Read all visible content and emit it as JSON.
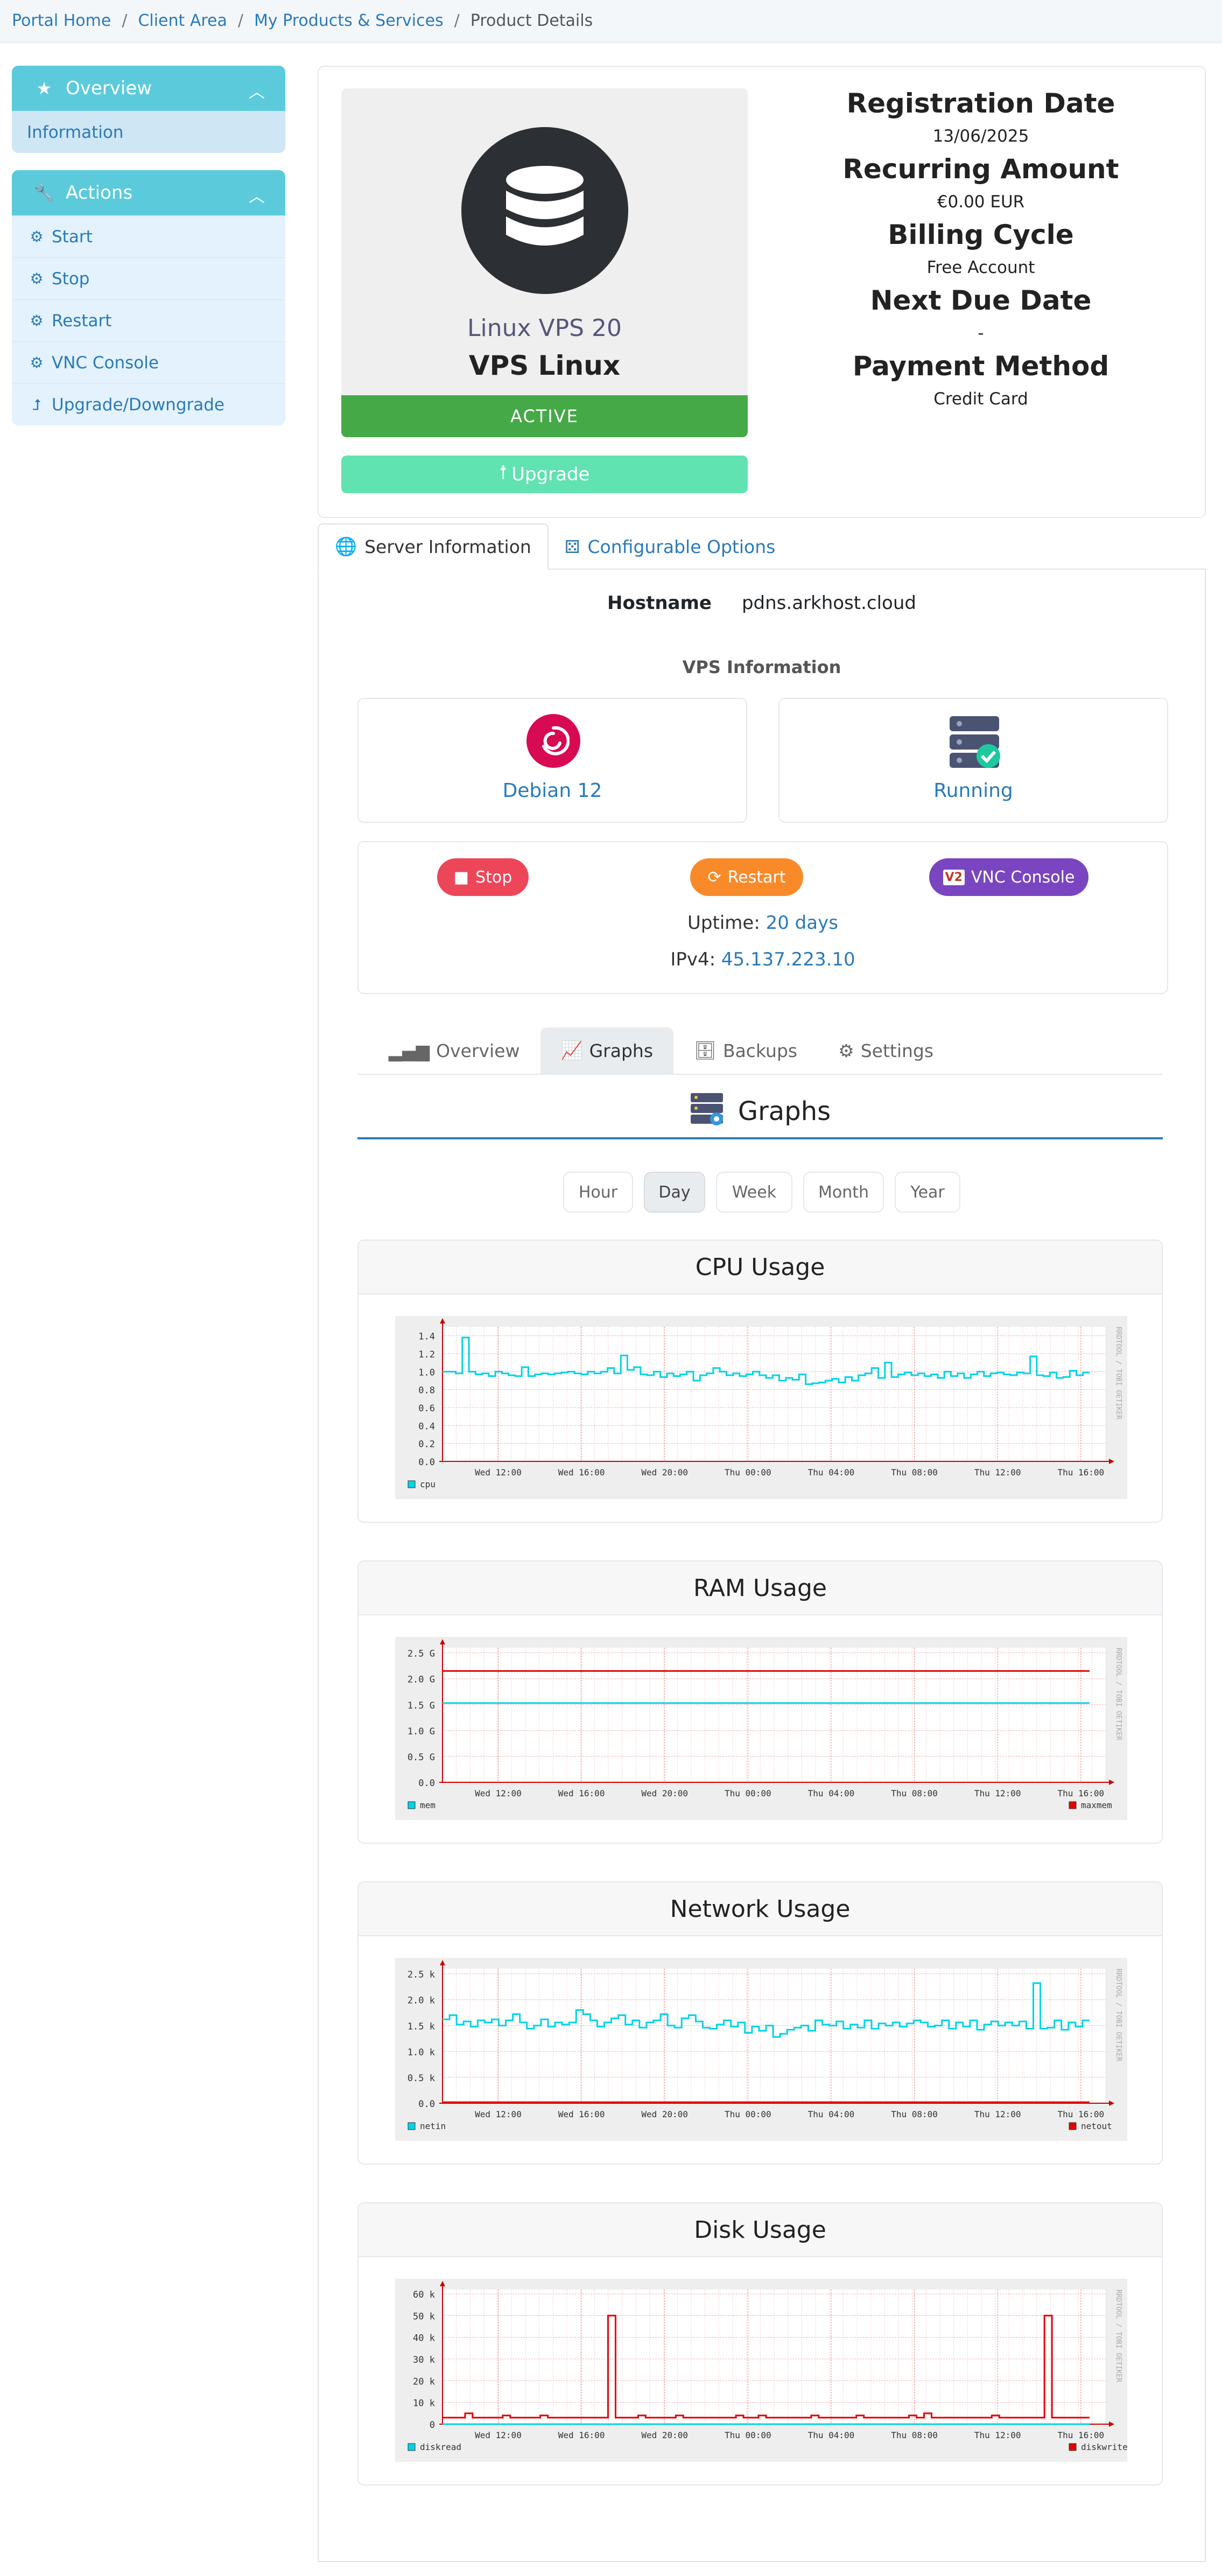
{
  "breadcrumb": {
    "items": [
      "Portal Home",
      "Client Area",
      "My Products & Services"
    ],
    "current": "Product Details",
    "sep": "/"
  },
  "sidebar": {
    "overview": {
      "title": "Overview",
      "items": [
        "Information"
      ]
    },
    "actions": {
      "title": "Actions",
      "items": [
        "Start",
        "Stop",
        "Restart",
        "VNC Console",
        "Upgrade/Downgrade"
      ]
    }
  },
  "product": {
    "name": "Linux VPS 20",
    "group": "VPS Linux",
    "status": "ACTIVE",
    "upgrade_label": "Upgrade",
    "info": [
      {
        "label": "Registration Date",
        "value": "13/06/2025"
      },
      {
        "label": "Recurring Amount",
        "value": "€0.00 EUR"
      },
      {
        "label": "Billing Cycle",
        "value": "Free Account"
      },
      {
        "label": "Next Due Date",
        "value": "-"
      },
      {
        "label": "Payment Method",
        "value": "Credit Card"
      }
    ]
  },
  "tabs": {
    "server": "Server Information",
    "config": "Configurable Options"
  },
  "server": {
    "hostname_label": "Hostname",
    "hostname": "pdns.arkhost.cloud",
    "vps_info_title": "VPS Information",
    "os": "Debian 12",
    "state": "Running",
    "buttons": {
      "stop": "Stop",
      "restart": "Restart",
      "vnc": "VNC Console"
    },
    "uptime_label": "Uptime:",
    "uptime": "20 days",
    "ipv4_label": "IPv4:",
    "ipv4": "45.137.223.10"
  },
  "subtabs": [
    "Overview",
    "Graphs",
    "Backups",
    "Settings"
  ],
  "graphs": {
    "title": "Graphs",
    "ranges": [
      "Hour",
      "Day",
      "Week",
      "Month",
      "Year"
    ],
    "active_range": "Day",
    "watermark": "RRDTOOL / TOBI OETIKER",
    "x_ticks": [
      "Wed 12:00",
      "Wed 16:00",
      "Wed 20:00",
      "Thu 00:00",
      "Thu 04:00",
      "Thu 08:00",
      "Thu 12:00",
      "Thu 16:00"
    ]
  },
  "colors": {
    "cyan": "#00d4e6",
    "red": "#e60000",
    "active": "#46a948",
    "upgrade": "#61e2b1",
    "stop": "#ee4659",
    "restart": "#f98a2a",
    "vnc": "#7a45c0"
  },
  "chart_data": [
    {
      "type": "line",
      "title": "CPU Usage",
      "y_ticks": [
        "1.4",
        "1.2",
        "1.0",
        "0.8",
        "0.6",
        "0.4",
        "0.2",
        "0.0"
      ],
      "ylim": [
        0,
        1.5
      ],
      "series": [
        {
          "name": "cpu",
          "color": "#00d4e6",
          "values": [
            1.0,
            1.0,
            0.98,
            1.38,
            1.0,
            0.97,
            0.98,
            0.95,
            1.0,
            0.98,
            0.96,
            0.95,
            1.05,
            0.95,
            0.97,
            0.98,
            0.97,
            0.98,
            0.99,
            1.0,
            0.98,
            0.97,
            1.0,
            0.98,
            1.0,
            1.04,
            0.98,
            1.18,
            1.02,
            1.05,
            0.97,
            0.96,
            1.0,
            0.94,
            0.98,
            0.95,
            0.97,
            1.0,
            0.9,
            0.96,
            0.98,
            1.04,
            1.0,
            0.96,
            0.98,
            0.95,
            0.97,
            1.0,
            0.96,
            0.93,
            0.96,
            0.9,
            0.93,
            0.91,
            0.97,
            0.86,
            0.87,
            0.88,
            0.9,
            0.92,
            0.88,
            0.94,
            0.9,
            0.96,
            0.98,
            1.04,
            0.93,
            1.1,
            0.94,
            0.97,
            0.99,
            0.96,
            0.98,
            0.95,
            0.97,
            0.93,
            1.0,
            0.95,
            0.98,
            0.93,
            0.97,
            1.0,
            0.95,
            0.98,
            0.99,
            0.97,
            0.96,
            0.99,
            0.98,
            1.17,
            0.96,
            0.95,
            0.99,
            0.93,
            0.94,
            1.01,
            0.96,
            0.99
          ]
        }
      ]
    },
    {
      "type": "line",
      "title": "RAM Usage",
      "y_ticks": [
        "2.5 G",
        "2.0 G",
        "1.5 G",
        "1.0 G",
        "0.5 G",
        "0.0"
      ],
      "ylim": [
        0,
        2.6
      ],
      "series": [
        {
          "name": "mem",
          "color": "#00d4e6",
          "values": [
            1.53,
            1.53
          ]
        },
        {
          "name": "maxmem",
          "color": "#e60000",
          "values": [
            2.15,
            2.15
          ]
        }
      ]
    },
    {
      "type": "line",
      "title": "Network Usage",
      "y_ticks": [
        "2.5 k",
        "2.0 k",
        "1.5 k",
        "1.0 k",
        "0.5 k",
        "0.0"
      ],
      "ylim": [
        0,
        2.6
      ],
      "series": [
        {
          "name": "netin",
          "color": "#00d4e6",
          "values": [
            1.62,
            1.7,
            1.52,
            1.58,
            1.48,
            1.6,
            1.56,
            1.62,
            1.5,
            1.6,
            1.72,
            1.56,
            1.44,
            1.5,
            1.62,
            1.48,
            1.56,
            1.52,
            1.56,
            1.8,
            1.72,
            1.6,
            1.48,
            1.56,
            1.64,
            1.7,
            1.52,
            1.6,
            1.46,
            1.56,
            1.6,
            1.72,
            1.5,
            1.46,
            1.64,
            1.7,
            1.58,
            1.46,
            1.44,
            1.52,
            1.6,
            1.48,
            1.56,
            1.36,
            1.48,
            1.4,
            1.5,
            1.28,
            1.34,
            1.42,
            1.46,
            1.5,
            1.4,
            1.6,
            1.52,
            1.5,
            1.58,
            1.44,
            1.52,
            1.46,
            1.6,
            1.44,
            1.54,
            1.5,
            1.56,
            1.48,
            1.54,
            1.6,
            1.56,
            1.48,
            1.5,
            1.6,
            1.44,
            1.56,
            1.48,
            1.6,
            1.42,
            1.52,
            1.58,
            1.5,
            1.56,
            1.5,
            1.58,
            1.44,
            2.32,
            1.44,
            1.46,
            1.6,
            1.42,
            1.56,
            1.48,
            1.6
          ]
        },
        {
          "name": "netout",
          "color": "#e60000",
          "values": [
            0.02,
            0.02
          ]
        }
      ]
    },
    {
      "type": "line",
      "title": "Disk Usage",
      "y_ticks": [
        "60 k",
        "50 k",
        "40 k",
        "30 k",
        "20 k",
        "10 k",
        "0"
      ],
      "ylim": [
        0,
        62
      ],
      "series": [
        {
          "name": "diskread",
          "color": "#00d4e6",
          "values": [
            0,
            0
          ]
        },
        {
          "name": "diskwrite",
          "color": "#e60000",
          "values": [
            3,
            3,
            3,
            5,
            3,
            3,
            3,
            3,
            4,
            3,
            3,
            3,
            3,
            4,
            3,
            3,
            3,
            3,
            3,
            3,
            3,
            3,
            50,
            3,
            3,
            3,
            4,
            3,
            3,
            3,
            3,
            4,
            3,
            3,
            3,
            3,
            3,
            3,
            3,
            4,
            3,
            3,
            4,
            3,
            3,
            3,
            3,
            3,
            3,
            4,
            3,
            3,
            3,
            3,
            3,
            4,
            3,
            3,
            3,
            3,
            3,
            3,
            4,
            3,
            5,
            3,
            3,
            3,
            3,
            3,
            3,
            3,
            3,
            4,
            3,
            3,
            3,
            3,
            3,
            3,
            50,
            3,
            3,
            3,
            3,
            3
          ]
        }
      ]
    }
  ]
}
